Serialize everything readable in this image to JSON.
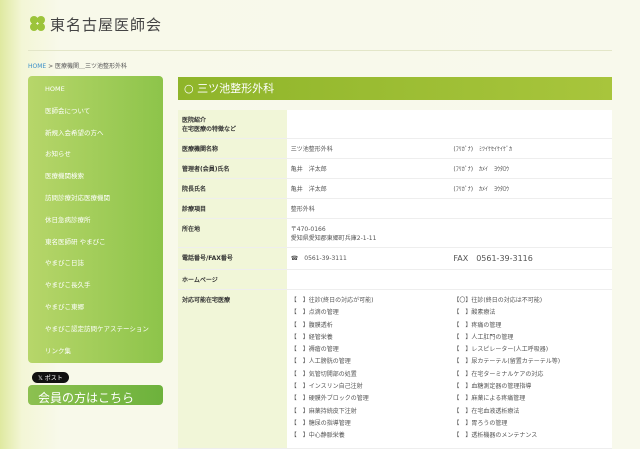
{
  "header": {
    "logo": "東名古屋医師会"
  },
  "breadcrumb": {
    "home": "HOME",
    "sep": " > ",
    "current": "医療機関＿三ツ池整形外科"
  },
  "sidebar": [
    "HOME",
    "医師会について",
    "新規入会希望の方へ",
    "お知らせ",
    "医療機関検索",
    "訪問診療対応医療機関",
    "休日急病診療所",
    "東名医師研 やまびこ",
    "やまびこ日誌",
    "やまびこ長久手",
    "やまびこ東郷",
    "やまびこ認定訪問ケアステーション",
    "リンク集"
  ],
  "post_button": "ポスト",
  "member_box": "会員の方はこちら",
  "page_title": "三ツ池整形外科",
  "rows": [
    {
      "label": "医院紹介\n在宅医療の特徴など",
      "v1": "",
      "v2": ""
    },
    {
      "label": "医療機関名称",
      "v1": "三ツ池整形外科",
      "v2": "(ﾌﾘｶﾞﾅ)　ﾐﾂｲｹｾｲｹｲｹﾞｶ"
    },
    {
      "label": "管理者(会員)氏名",
      "v1": "亀井　洋太郎",
      "v2": "(ﾌﾘｶﾞﾅ)　ｶﾒｲ　ﾖｳﾀﾛｳ"
    },
    {
      "label": "院長氏名",
      "v1": "亀井　洋太郎",
      "v2": "(ﾌﾘｶﾞﾅ)　ｶﾒｲ　ﾖｳﾀﾛｳ"
    },
    {
      "label": "診療項目",
      "v1": "整形外科",
      "v2": ""
    },
    {
      "label": "所在地",
      "v1": "〒470-0166\n愛知県愛知郡東郷町兵庫2-1-11",
      "v2": ""
    },
    {
      "label": "電話番号/FAX番号",
      "v1": "☎　0561-39-3111",
      "v2": "FAX　0561-39-3116"
    },
    {
      "label": "ホームページ",
      "v1": "",
      "v2": ""
    },
    {
      "label": "対応可能在宅医療",
      "v1": "",
      "v2": ""
    }
  ],
  "services_left": [
    "【　】往診(終日の対応が可能)",
    "【　】点滴の管理",
    "【　】腹膜透析",
    "【　】経管栄養",
    "【　】褥瘡の管理",
    "【　】人工膀胱の管理",
    "【　】気管切開部の処置",
    "【　】インスリン自己注射",
    "【　】硬膜外ブロックの管理",
    "【　】麻薬持続皮下注射",
    "【　】糖尿の指導管理",
    "【　】中心静脈栄養"
  ],
  "services_right": [
    "【〇】往診(終日の対応は不可能)",
    "【　】酸素療法",
    "【　】疼痛の管理",
    "【　】人工肛門の管理",
    "【　】レスピレーター(人工呼吸器)",
    "【　】尿カテーテル(留置カテーテル等)",
    "【　】在宅ターミナルケアの対応",
    "【　】血糖測定器の管理指導",
    "【　】麻薬による疼痛管理",
    "【　】在宅血液透析療法",
    "【　】胃ろうの管理",
    "【　】透析機器のメンテナンス"
  ]
}
